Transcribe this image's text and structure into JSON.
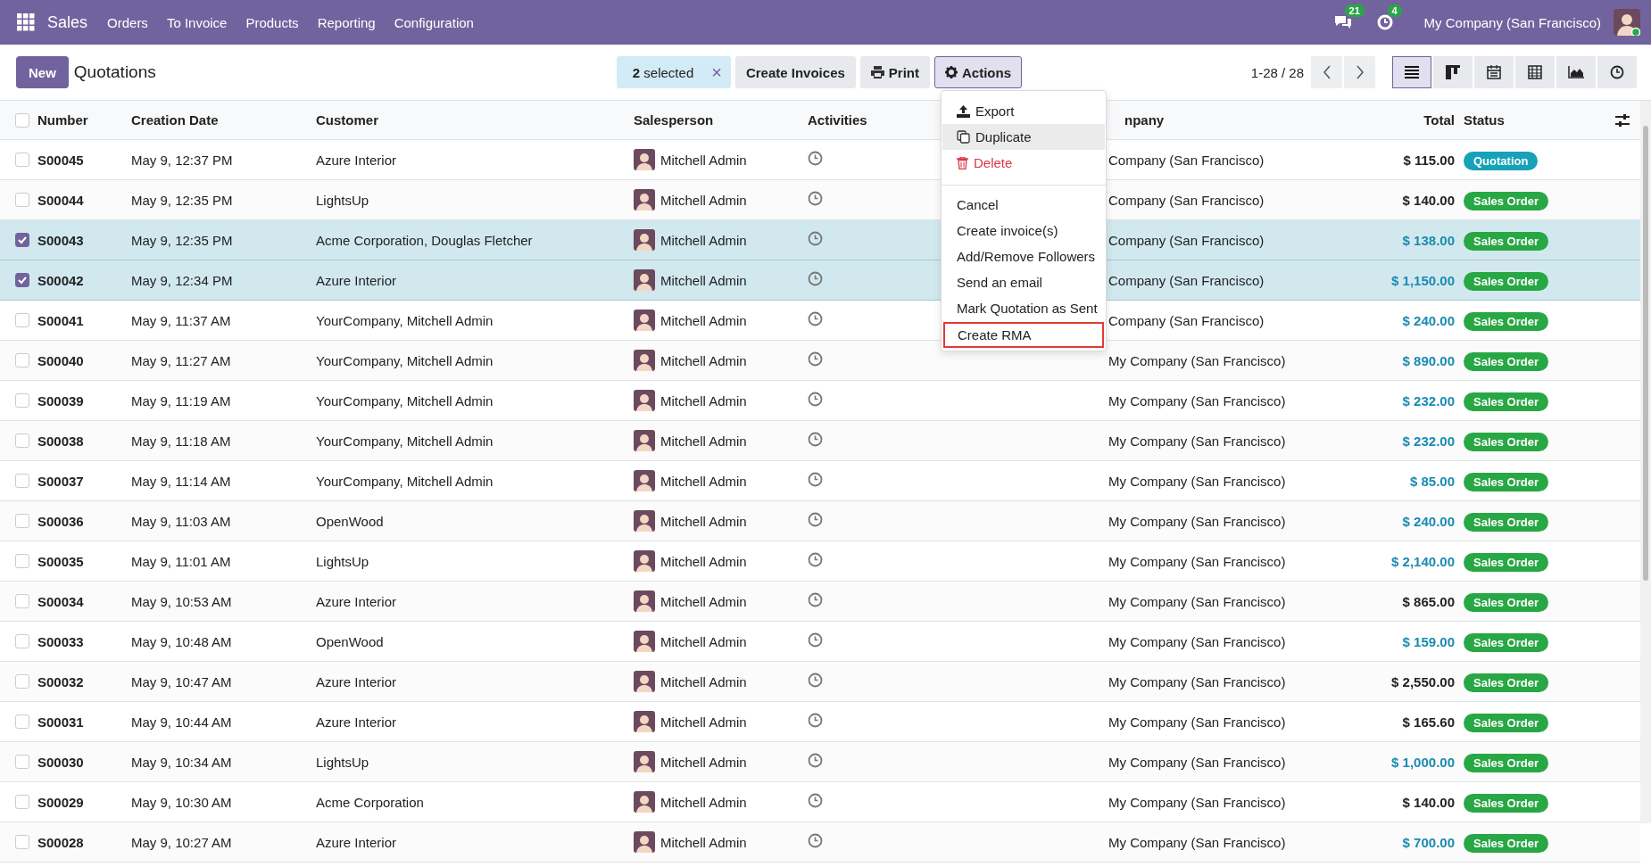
{
  "navbar": {
    "app": "Sales",
    "menu": [
      "Orders",
      "To Invoice",
      "Products",
      "Reporting",
      "Configuration"
    ],
    "messages_count": "21",
    "activities_count": "4",
    "company": "My Company (San Francisco)"
  },
  "control_panel": {
    "new_button": "New",
    "title": "Quotations",
    "selection": {
      "count": "2",
      "label": "selected",
      "clear": "×"
    },
    "buttons": [
      {
        "label": "Create Invoices",
        "kind": "plain",
        "selected": false
      },
      {
        "label": "Print",
        "kind": "print",
        "selected": false
      },
      {
        "label": "Actions",
        "kind": "gear",
        "selected": true
      }
    ],
    "pager": "1-28 / 28",
    "views": [
      {
        "kind": "list",
        "selected": true
      },
      {
        "kind": "kanban",
        "selected": false
      },
      {
        "kind": "calendar",
        "selected": false
      },
      {
        "kind": "pivot",
        "selected": false
      },
      {
        "kind": "graph",
        "selected": false
      },
      {
        "kind": "activity",
        "selected": false
      }
    ]
  },
  "actions_menu": [
    {
      "label": "Export",
      "kind": "export",
      "hovered": false,
      "outlined": false
    },
    {
      "label": "Duplicate",
      "kind": "duplicate",
      "hovered": true,
      "outlined": false
    },
    {
      "label": "Delete",
      "kind": "delete",
      "hovered": false,
      "outlined": false
    },
    {
      "kind": "separator"
    },
    {
      "label": "Cancel",
      "kind": "action",
      "hovered": false,
      "outlined": false
    },
    {
      "label": "Create invoice(s)",
      "kind": "action",
      "hovered": false,
      "outlined": false
    },
    {
      "label": "Add/Remove Followers",
      "kind": "action",
      "hovered": false,
      "outlined": false
    },
    {
      "label": "Send an email",
      "kind": "action",
      "hovered": false,
      "outlined": false
    },
    {
      "label": "Mark Quotation as Sent",
      "kind": "action",
      "hovered": false,
      "outlined": false
    },
    {
      "label": "Create RMA",
      "kind": "action",
      "hovered": false,
      "outlined": true
    }
  ],
  "table": {
    "all_checked": false,
    "columns": [
      "Number",
      "Creation Date",
      "Customer",
      "Salesperson",
      "Activities",
      "npany",
      "Total",
      "Status"
    ],
    "rows": [
      {
        "number": "S00045",
        "date": "May 9, 12:37 PM",
        "customer": "Azure Interior",
        "salesperson": "Mitchell Admin",
        "company": "Company (San Francisco)",
        "total": "$ 115.00",
        "total_highlighted": false,
        "status": {
          "label": "Quotation",
          "color": "#17a2b8"
        },
        "selected": false
      },
      {
        "number": "S00044",
        "date": "May 9, 12:35 PM",
        "customer": "LightsUp",
        "salesperson": "Mitchell Admin",
        "company": "Company (San Francisco)",
        "total": "$ 140.00",
        "total_highlighted": false,
        "status": {
          "label": "Sales Order",
          "color": "#28a745"
        },
        "selected": false
      },
      {
        "number": "S00043",
        "date": "May 9, 12:35 PM",
        "customer": "Acme Corporation, Douglas Fletcher",
        "salesperson": "Mitchell Admin",
        "company": "Company (San Francisco)",
        "total": "$ 138.00",
        "total_highlighted": true,
        "status": {
          "label": "Sales Order",
          "color": "#28a745"
        },
        "selected": true
      },
      {
        "number": "S00042",
        "date": "May 9, 12:34 PM",
        "customer": "Azure Interior",
        "salesperson": "Mitchell Admin",
        "company": "Company (San Francisco)",
        "total": "$ 1,150.00",
        "total_highlighted": true,
        "status": {
          "label": "Sales Order",
          "color": "#28a745"
        },
        "selected": true
      },
      {
        "number": "S00041",
        "date": "May 9, 11:37 AM",
        "customer": "YourCompany, Mitchell Admin",
        "salesperson": "Mitchell Admin",
        "company": "Company (San Francisco)",
        "total": "$ 240.00",
        "total_highlighted": true,
        "status": {
          "label": "Sales Order",
          "color": "#28a745"
        },
        "selected": false
      },
      {
        "number": "S00040",
        "date": "May 9, 11:27 AM",
        "customer": "YourCompany, Mitchell Admin",
        "salesperson": "Mitchell Admin",
        "company": "My Company (San Francisco)",
        "total": "$ 890.00",
        "total_highlighted": true,
        "status": {
          "label": "Sales Order",
          "color": "#28a745"
        },
        "selected": false
      },
      {
        "number": "S00039",
        "date": "May 9, 11:19 AM",
        "customer": "YourCompany, Mitchell Admin",
        "salesperson": "Mitchell Admin",
        "company": "My Company (San Francisco)",
        "total": "$ 232.00",
        "total_highlighted": true,
        "status": {
          "label": "Sales Order",
          "color": "#28a745"
        },
        "selected": false
      },
      {
        "number": "S00038",
        "date": "May 9, 11:18 AM",
        "customer": "YourCompany, Mitchell Admin",
        "salesperson": "Mitchell Admin",
        "company": "My Company (San Francisco)",
        "total": "$ 232.00",
        "total_highlighted": true,
        "status": {
          "label": "Sales Order",
          "color": "#28a745"
        },
        "selected": false
      },
      {
        "number": "S00037",
        "date": "May 9, 11:14 AM",
        "customer": "YourCompany, Mitchell Admin",
        "salesperson": "Mitchell Admin",
        "company": "My Company (San Francisco)",
        "total": "$ 85.00",
        "total_highlighted": true,
        "status": {
          "label": "Sales Order",
          "color": "#28a745"
        },
        "selected": false
      },
      {
        "number": "S00036",
        "date": "May 9, 11:03 AM",
        "customer": "OpenWood",
        "salesperson": "Mitchell Admin",
        "company": "My Company (San Francisco)",
        "total": "$ 240.00",
        "total_highlighted": true,
        "status": {
          "label": "Sales Order",
          "color": "#28a745"
        },
        "selected": false
      },
      {
        "number": "S00035",
        "date": "May 9, 11:01 AM",
        "customer": "LightsUp",
        "salesperson": "Mitchell Admin",
        "company": "My Company (San Francisco)",
        "total": "$ 2,140.00",
        "total_highlighted": true,
        "status": {
          "label": "Sales Order",
          "color": "#28a745"
        },
        "selected": false
      },
      {
        "number": "S00034",
        "date": "May 9, 10:53 AM",
        "customer": "Azure Interior",
        "salesperson": "Mitchell Admin",
        "company": "My Company (San Francisco)",
        "total": "$ 865.00",
        "total_highlighted": false,
        "status": {
          "label": "Sales Order",
          "color": "#28a745"
        },
        "selected": false
      },
      {
        "number": "S00033",
        "date": "May 9, 10:48 AM",
        "customer": "OpenWood",
        "salesperson": "Mitchell Admin",
        "company": "My Company (San Francisco)",
        "total": "$ 159.00",
        "total_highlighted": true,
        "status": {
          "label": "Sales Order",
          "color": "#28a745"
        },
        "selected": false
      },
      {
        "number": "S00032",
        "date": "May 9, 10:47 AM",
        "customer": "Azure Interior",
        "salesperson": "Mitchell Admin",
        "company": "My Company (San Francisco)",
        "total": "$ 2,550.00",
        "total_highlighted": false,
        "status": {
          "label": "Sales Order",
          "color": "#28a745"
        },
        "selected": false
      },
      {
        "number": "S00031",
        "date": "May 9, 10:44 AM",
        "customer": "Azure Interior",
        "salesperson": "Mitchell Admin",
        "company": "My Company (San Francisco)",
        "total": "$ 165.60",
        "total_highlighted": false,
        "status": {
          "label": "Sales Order",
          "color": "#28a745"
        },
        "selected": false
      },
      {
        "number": "S00030",
        "date": "May 9, 10:34 AM",
        "customer": "LightsUp",
        "salesperson": "Mitchell Admin",
        "company": "My Company (San Francisco)",
        "total": "$ 1,000.00",
        "total_highlighted": true,
        "status": {
          "label": "Sales Order",
          "color": "#28a745"
        },
        "selected": false
      },
      {
        "number": "S00029",
        "date": "May 9, 10:30 AM",
        "customer": "Acme Corporation",
        "salesperson": "Mitchell Admin",
        "company": "My Company (San Francisco)",
        "total": "$ 140.00",
        "total_highlighted": false,
        "status": {
          "label": "Sales Order",
          "color": "#28a745"
        },
        "selected": false
      },
      {
        "number": "S00028",
        "date": "May 9, 10:27 AM",
        "customer": "Azure Interior",
        "salesperson": "Mitchell Admin",
        "company": "My Company (San Francisco)",
        "total": "$ 700.00",
        "total_highlighted": true,
        "status": {
          "label": "Sales Order",
          "color": "#28a745"
        },
        "selected": false
      }
    ]
  }
}
